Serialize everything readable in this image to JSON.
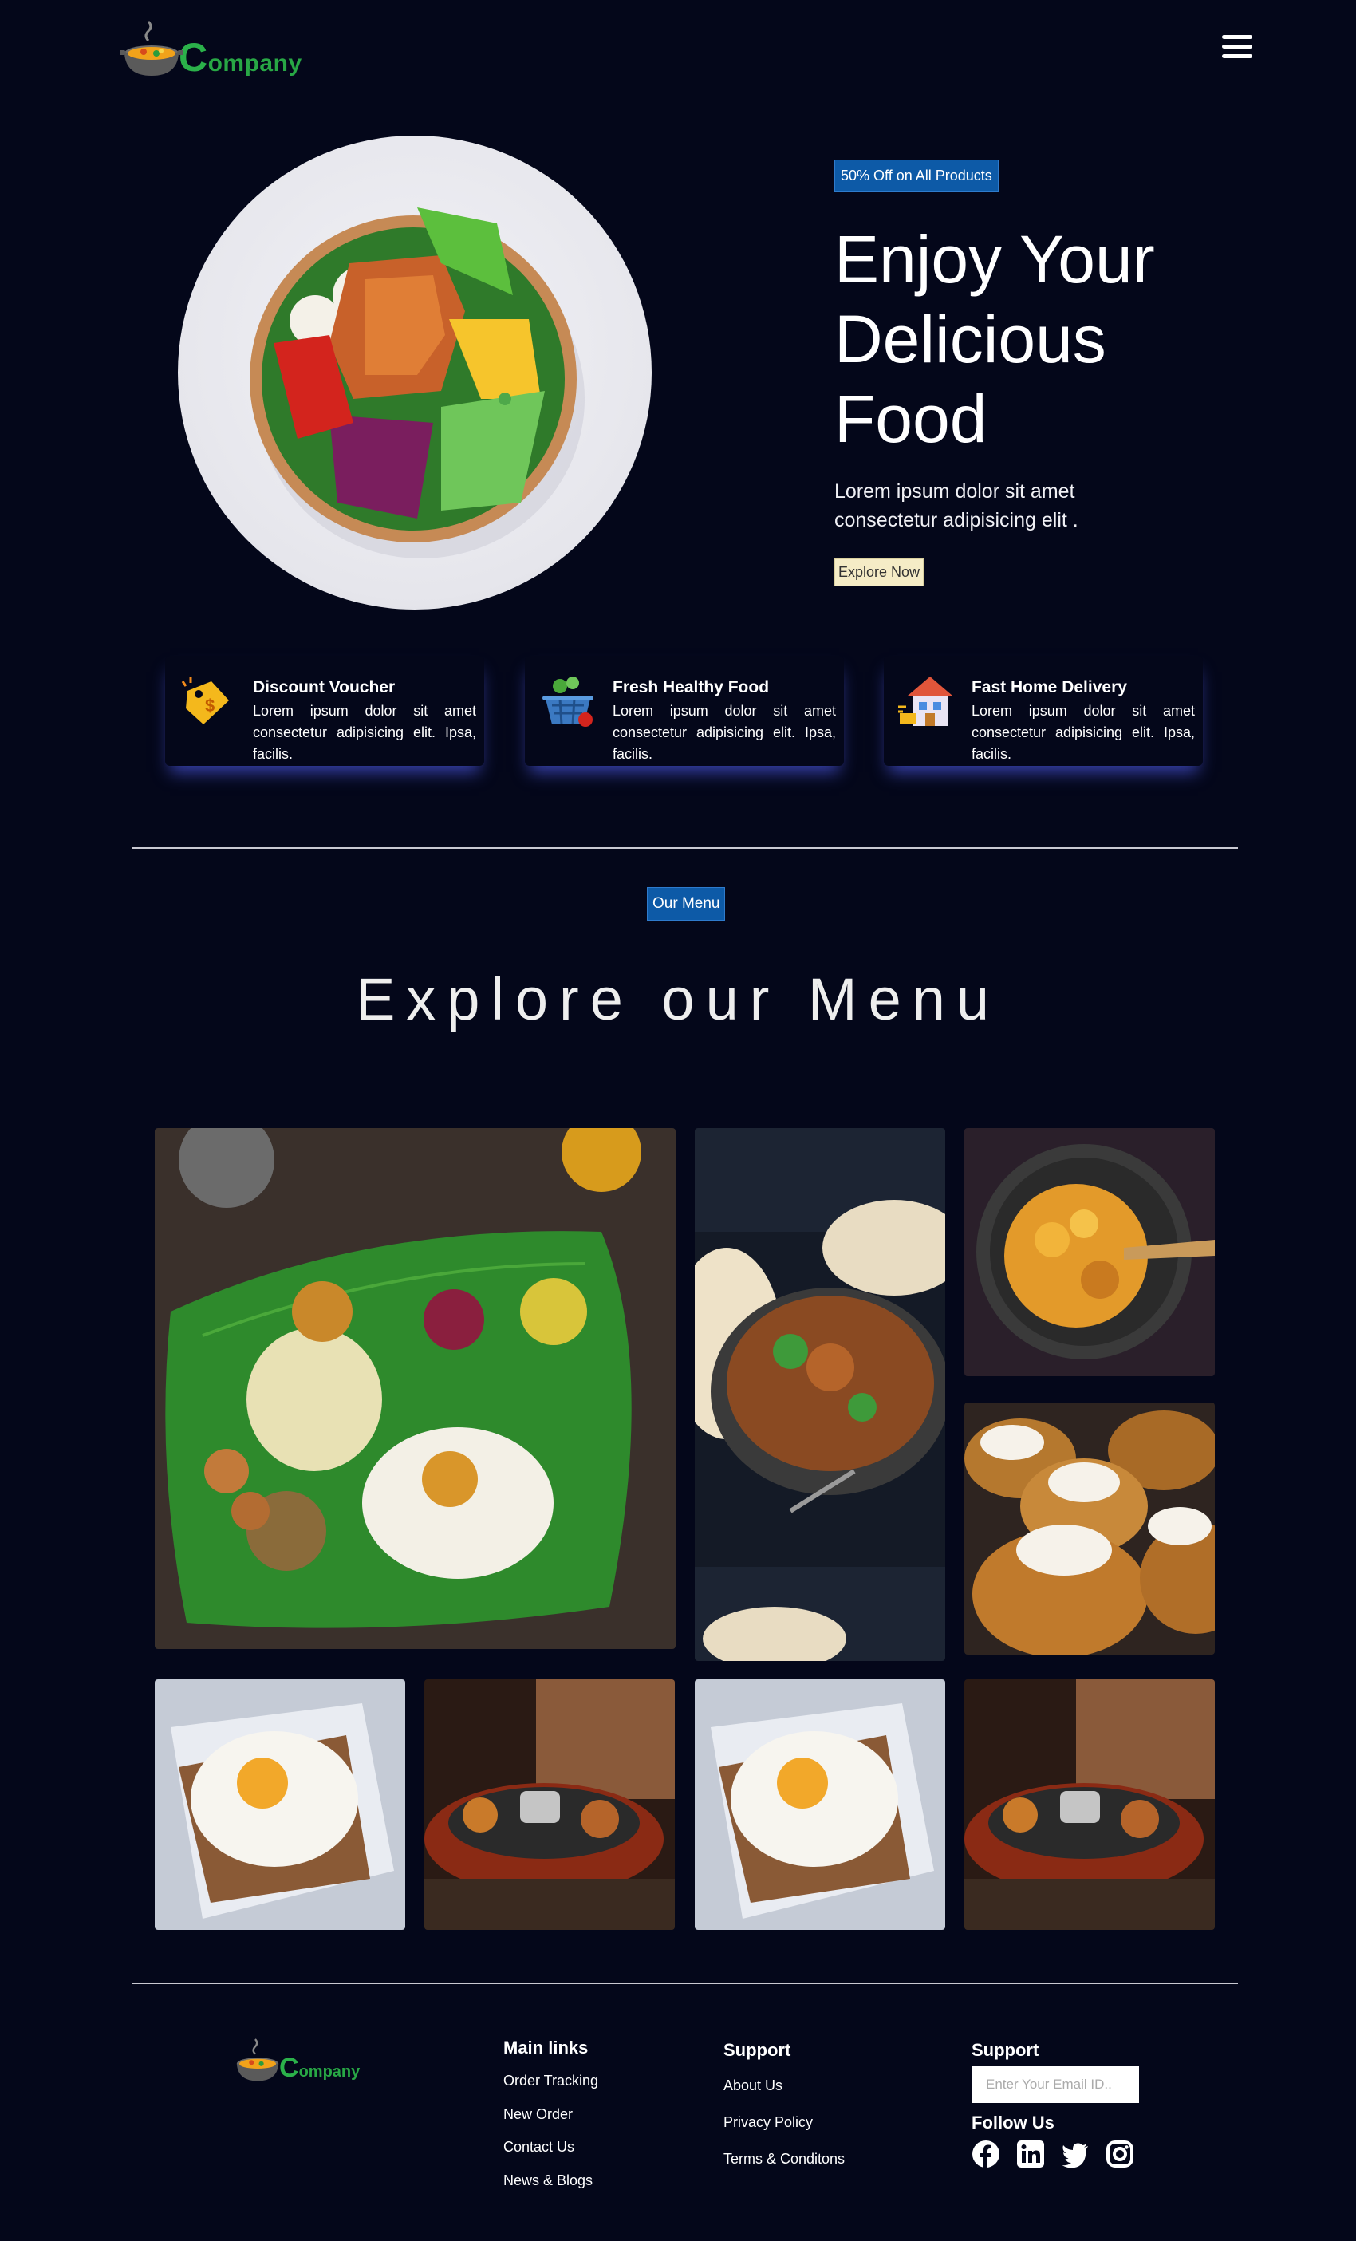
{
  "header": {
    "logo_letter": "C",
    "logo_text": "ompany",
    "menu_icon": "hamburger-icon"
  },
  "hero": {
    "badge": "50% Off on All Products",
    "title_lines": [
      "Enjoy Your",
      "Delicious",
      "Food"
    ],
    "text": "Lorem ipsum dolor sit amet consectetur adipisicing elit .",
    "button": "Explore Now",
    "image_alt": "salad-bowl"
  },
  "features": [
    {
      "icon": "discount-tag-icon",
      "title": "Discount Voucher",
      "text": "Lorem ipsum dolor sit amet consectetur adipisicing elit. Ipsa, facilis."
    },
    {
      "icon": "grocery-basket-icon",
      "title": "Fresh Healthy Food",
      "text": "Lorem ipsum dolor sit amet consectetur adipisicing elit. Ipsa, facilis."
    },
    {
      "icon": "delivery-house-icon",
      "title": "Fast Home Delivery",
      "text": "Lorem ipsum dolor sit amet consectetur adipisicing elit. Ipsa, facilis."
    }
  ],
  "menu": {
    "badge": "Our Menu",
    "heading": "Explore our Menu",
    "tiles": [
      "banana-leaf-meal",
      "curry-pan",
      "roasted-potatoes",
      "cream-pastries",
      "egg-toast",
      "sizzler-plate",
      "egg-toast",
      "sizzler-plate"
    ]
  },
  "footer": {
    "logo_letter": "C",
    "logo_text": "ompany",
    "main_links": {
      "title": "Main links",
      "items": [
        "Order Tracking",
        "New Order",
        "Contact Us",
        "News & Blogs"
      ]
    },
    "support_links": {
      "title": "Support",
      "items": [
        "About Us",
        "Privacy Policy",
        "Terms & Conditons"
      ]
    },
    "newsletter": {
      "title": "Support",
      "placeholder": "Enter Your Email ID..",
      "follow": "Follow Us"
    },
    "social_icons": [
      "facebook-icon",
      "linkedin-icon",
      "twitter-icon",
      "instagram-icon"
    ]
  },
  "colors": {
    "background": "#04071a",
    "brand_green": "#2bb14a",
    "badge_blue": "#0d5aa7",
    "button_cream": "#f5ecc6",
    "card_glow": "#4a56dc"
  }
}
